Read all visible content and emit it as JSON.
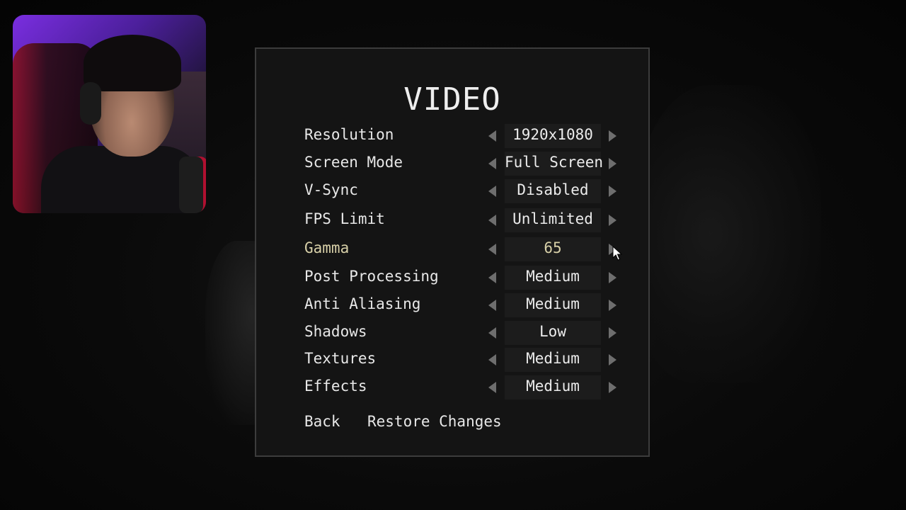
{
  "menu": {
    "title": "VIDEO",
    "settings": [
      {
        "label": "Resolution",
        "value": "1920x1080"
      },
      {
        "label": "Screen Mode",
        "value": "Full Screen"
      },
      {
        "label": "V-Sync",
        "value": "Disabled"
      },
      {
        "label": "FPS Limit",
        "value": "Unlimited"
      },
      {
        "label": "Gamma",
        "value": "65"
      },
      {
        "label": "Post Processing",
        "value": "Medium"
      },
      {
        "label": "Anti Aliasing",
        "value": "Medium"
      },
      {
        "label": "Shadows",
        "value": "Low"
      },
      {
        "label": "Textures",
        "value": "Medium"
      },
      {
        "label": "Effects",
        "value": "Medium"
      }
    ],
    "back_label": "Back",
    "restore_label": "Restore Changes",
    "highlighted_setting": "Gamma"
  },
  "colors": {
    "panel_bg": "#141414",
    "panel_border": "#3c3c3c",
    "text": "#e8e8e8",
    "highlight_text": "#d8d0a8",
    "arrow": "#6e6e6e",
    "webcam_accent": "#7a2ee0"
  },
  "icons": {
    "decrease": "triangle-left-icon",
    "increase": "triangle-right-icon",
    "pointer": "mouse-cursor-icon"
  }
}
